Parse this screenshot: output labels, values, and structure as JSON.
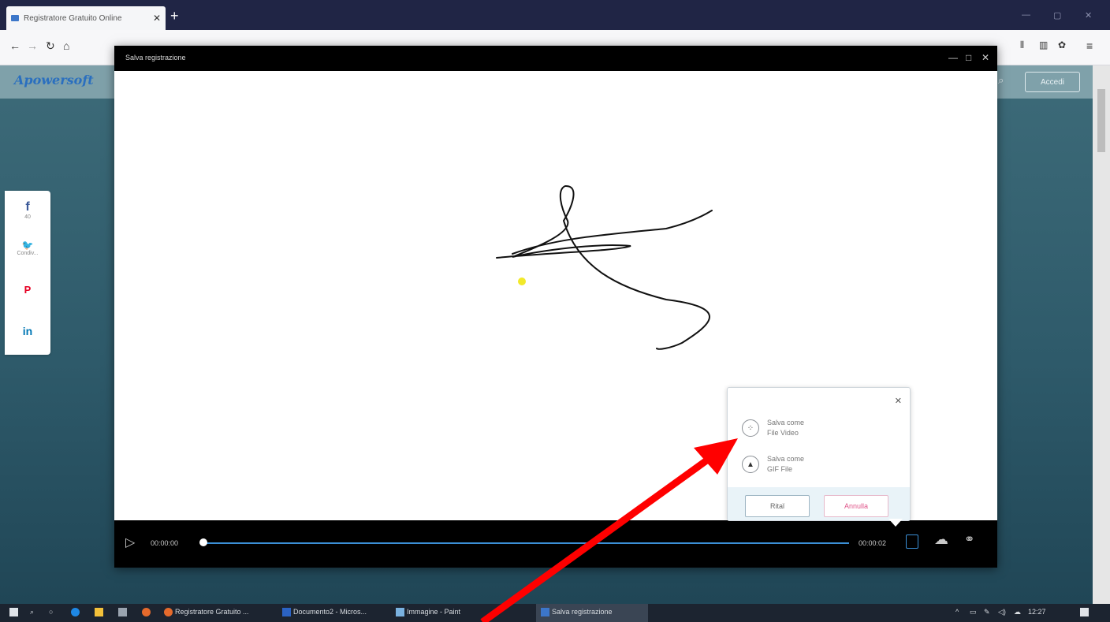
{
  "browser": {
    "tab_title": "Registratore Gratuito Online",
    "tab_close": "✕",
    "new_tab": "+",
    "controls": {
      "minimize": "—",
      "maximize": "▢",
      "close": "✕"
    }
  },
  "page": {
    "logo": "Apowersoft",
    "login_button": "Accedi",
    "share": [
      {
        "icon": "f",
        "label": "40"
      },
      {
        "icon": "🐦",
        "label": "Condiv..."
      },
      {
        "icon": "P",
        "label": ""
      },
      {
        "icon": "in",
        "label": ""
      }
    ]
  },
  "dialog": {
    "title": "Salva registrazione",
    "controls": {
      "minimize": "—",
      "maximize": "□",
      "close": "✕"
    },
    "player": {
      "time_current": "00:00:00",
      "time_total": "00:00:02"
    }
  },
  "save_popup": {
    "close": "✕",
    "option_video": {
      "line1": "Salva come",
      "line2": "File Video"
    },
    "option_gif": {
      "line1": "Salva come",
      "line2": "GIF File"
    },
    "ok_label": "Ritaǐ",
    "cancel_label": "Annulla"
  },
  "taskbar": {
    "items": [
      {
        "label": "Registratore Gratuito ..."
      },
      {
        "label": "Documento2 - Micros..."
      },
      {
        "label": "Immagine - Paint"
      },
      {
        "label": "Salva registrazione"
      }
    ],
    "clock": "12:27"
  },
  "colors": {
    "accent": "#3b8fd6",
    "annotation_arrow": "#ff0000",
    "cancel_text": "#e0568a"
  }
}
